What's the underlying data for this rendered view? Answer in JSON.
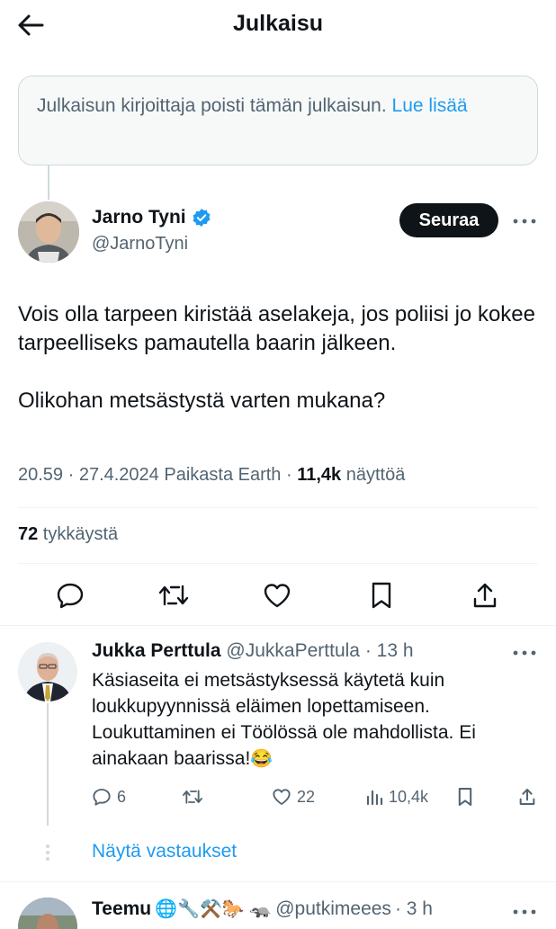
{
  "header": {
    "title": "Julkaisu"
  },
  "deleted_notice": {
    "text": "Julkaisun kirjoittaja poisti tämän julkaisun.",
    "link": "Lue lisää"
  },
  "post": {
    "author_name": "Jarno Tyni",
    "author_handle": "@JarnoTyni",
    "follow_label": "Seuraa",
    "paragraphs": [
      "Vois olla tarpeen kiristää aselakeja, jos poliisi jo kokee tarpeelliseks pamautella baarin jälkeen.",
      "Olikohan metsästystä varten mukana?"
    ],
    "meta_prefix": "20.59 · 27.4.2024 Paikasta Earth · ",
    "views_count": "11,4k",
    "views_label": " näyttöä",
    "likes_count": "72",
    "likes_label": " tykkäystä"
  },
  "reply": {
    "author_name": "Jukka Perttula",
    "author_handle": "@JukkaPerttula",
    "time": "· 13 h",
    "text": "Käsiaseita ei metsästyksessä käytetä kuin loukkupyynnissä eläimen lopettamiseen. Loukuttaminen ei Töölössä ole mahdollista. Ei ainakaan baarissa!",
    "text_emoji": "😂",
    "reply_count": "6",
    "like_count": "22",
    "view_count": "10,4k",
    "show_replies": "Näytä vastaukset"
  },
  "next_reply": {
    "author_name": "Teemu",
    "emojis": "🌐🔧⚒️🐎 🦡",
    "author_handle": "@putkimeees",
    "time": "· 3 h"
  },
  "colors": {
    "accent": "#1d9bf0",
    "text": "#0f1419",
    "muted": "#536471",
    "border": "#cfd9de"
  }
}
